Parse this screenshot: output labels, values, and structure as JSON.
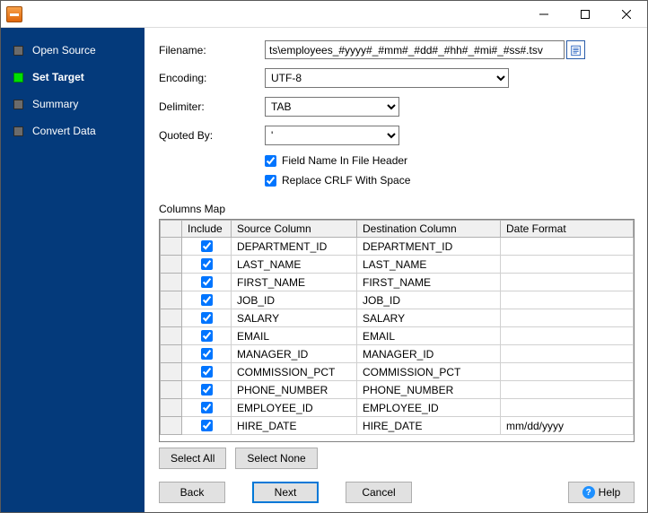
{
  "sidebar": {
    "items": [
      {
        "label": "Open Source",
        "active": false
      },
      {
        "label": "Set Target",
        "active": true
      },
      {
        "label": "Summary",
        "active": false
      },
      {
        "label": "Convert Data",
        "active": false
      }
    ]
  },
  "form": {
    "filename_label": "Filename:",
    "filename_value": "ts\\employees_#yyyy#_#mm#_#dd#_#hh#_#mi#_#ss#.tsv",
    "encoding_label": "Encoding:",
    "encoding_value": "UTF-8",
    "delimiter_label": "Delimiter:",
    "delimiter_value": "TAB",
    "quoted_label": "Quoted By:",
    "quoted_value": "'",
    "chk_header_label": "Field Name In File Header",
    "chk_header_checked": true,
    "chk_crlf_label": "Replace CRLF With Space",
    "chk_crlf_checked": true
  },
  "columns_map": {
    "title": "Columns Map",
    "headers": {
      "include": "Include",
      "source": "Source Column",
      "dest": "Destination Column",
      "fmt": "Date Format"
    },
    "rows": [
      {
        "include": true,
        "source": "DEPARTMENT_ID",
        "dest": "DEPARTMENT_ID",
        "fmt": ""
      },
      {
        "include": true,
        "source": "LAST_NAME",
        "dest": "LAST_NAME",
        "fmt": ""
      },
      {
        "include": true,
        "source": "FIRST_NAME",
        "dest": "FIRST_NAME",
        "fmt": ""
      },
      {
        "include": true,
        "source": "JOB_ID",
        "dest": "JOB_ID",
        "fmt": ""
      },
      {
        "include": true,
        "source": "SALARY",
        "dest": "SALARY",
        "fmt": ""
      },
      {
        "include": true,
        "source": "EMAIL",
        "dest": "EMAIL",
        "fmt": ""
      },
      {
        "include": true,
        "source": "MANAGER_ID",
        "dest": "MANAGER_ID",
        "fmt": ""
      },
      {
        "include": true,
        "source": "COMMISSION_PCT",
        "dest": "COMMISSION_PCT",
        "fmt": ""
      },
      {
        "include": true,
        "source": "PHONE_NUMBER",
        "dest": "PHONE_NUMBER",
        "fmt": ""
      },
      {
        "include": true,
        "source": "EMPLOYEE_ID",
        "dest": "EMPLOYEE_ID",
        "fmt": ""
      },
      {
        "include": true,
        "source": "HIRE_DATE",
        "dest": "HIRE_DATE",
        "fmt": "mm/dd/yyyy"
      }
    ]
  },
  "buttons": {
    "select_all": "Select All",
    "select_none": "Select None",
    "back": "Back",
    "next": "Next",
    "cancel": "Cancel",
    "help": "Help"
  }
}
